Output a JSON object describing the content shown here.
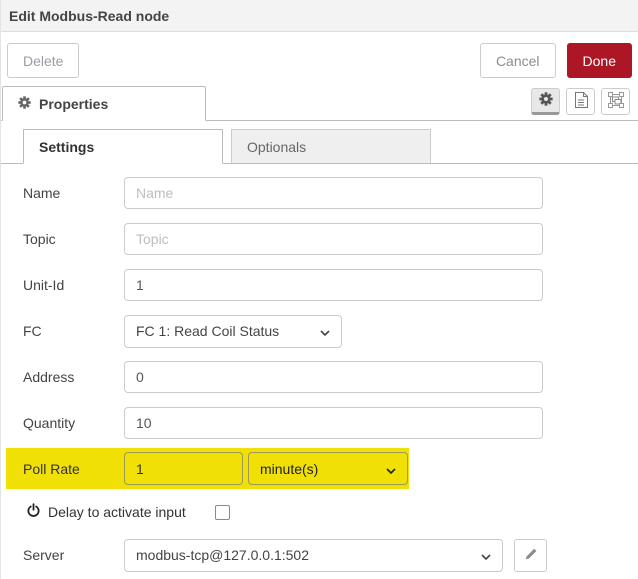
{
  "window": {
    "title": "Edit Modbus-Read node"
  },
  "buttons": {
    "delete": "Delete",
    "cancel": "Cancel",
    "done": "Done"
  },
  "properties_tab": {
    "label": "Properties"
  },
  "toolbar": {
    "icons": [
      "gear-icon",
      "description-icon",
      "appearance-icon"
    ],
    "active_icon": "gear-icon"
  },
  "subtabs": {
    "settings": "Settings",
    "optionals": "Optionals",
    "active": "Settings"
  },
  "form": {
    "name": {
      "label": "Name",
      "value": "",
      "placeholder": "Name"
    },
    "topic": {
      "label": "Topic",
      "value": "",
      "placeholder": "Topic"
    },
    "unit_id": {
      "label": "Unit-Id",
      "value": "1"
    },
    "fc": {
      "label": "FC",
      "value": "FC 1: Read Coil Status"
    },
    "address": {
      "label": "Address",
      "value": "0"
    },
    "quantity": {
      "label": "Quantity",
      "value": "10"
    },
    "poll_rate": {
      "label": "Poll Rate",
      "value": "1",
      "unit": "minute(s)",
      "highlighted": true
    },
    "delay": {
      "label": "Delay to activate input",
      "checked": false
    },
    "server": {
      "label": "Server",
      "value": "modbus-tcp@127.0.0.1:502"
    }
  },
  "colors": {
    "done_red": "#AD1625",
    "highlight_yellow": "#F0E005",
    "header_bg": "#f3f3f3"
  }
}
